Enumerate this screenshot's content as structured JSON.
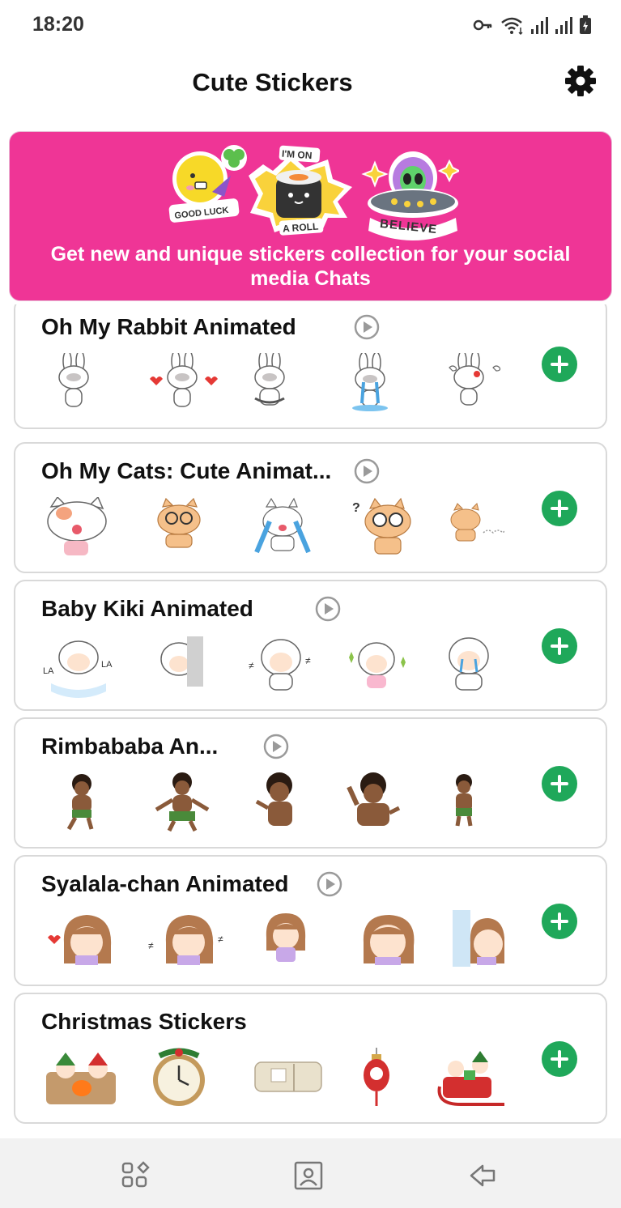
{
  "status_bar": {
    "time": "18:20",
    "icons": [
      "key-icon",
      "wifi-icon",
      "signal-icon",
      "signal-icon",
      "battery-charging-icon"
    ]
  },
  "app_bar": {
    "title": "Cute Stickers",
    "settings_icon": "gear-icon"
  },
  "banner": {
    "text": "Get new and unique stickers collection for your social media Chats",
    "stickers": [
      {
        "name": "good-luck-sticker",
        "caption": "GOOD LUCK"
      },
      {
        "name": "im-on-a-roll-sticker",
        "caption_top": "I'M ON",
        "caption_bottom": "A ROLL"
      },
      {
        "name": "believe-ufo-sticker",
        "caption": "BELIEVE"
      }
    ],
    "color": "#ef3596"
  },
  "packs": [
    {
      "title": "Oh My Rabbit Animated",
      "stickers": [
        "rabbit-1",
        "rabbit-2",
        "rabbit-3",
        "rabbit-4",
        "rabbit-5"
      ]
    },
    {
      "title": "Oh My Cats: Cute Animat...",
      "stickers": [
        "cat-1",
        "cat-2",
        "cat-3",
        "cat-4",
        "cat-5"
      ]
    },
    {
      "title": "Baby Kiki Animated",
      "stickers": [
        "kiki-1",
        "kiki-2",
        "kiki-3",
        "kiki-4",
        "kiki-5"
      ]
    },
    {
      "title": "Rimbababa An...",
      "stickers": [
        "rimba-1",
        "rimba-2",
        "rimba-3",
        "rimba-4",
        "rimba-5"
      ]
    },
    {
      "title": "Syalala-chan Animated",
      "stickers": [
        "syalala-1",
        "syalala-2",
        "syalala-3",
        "syalala-4",
        "syalala-5"
      ]
    },
    {
      "title": "Christmas Stickers",
      "stickers": [
        "xmas-1",
        "xmas-2",
        "xmas-3",
        "xmas-4",
        "xmas-5"
      ]
    }
  ],
  "sticker_art": {
    "rabbit": "　",
    "la": "LA"
  },
  "bottom_nav": {
    "items": [
      "recent-apps-icon",
      "home-icon",
      "back-icon"
    ]
  },
  "colors": {
    "accent": "#1fa85a",
    "banner": "#ef3596",
    "card_border": "#d9d9d9"
  }
}
